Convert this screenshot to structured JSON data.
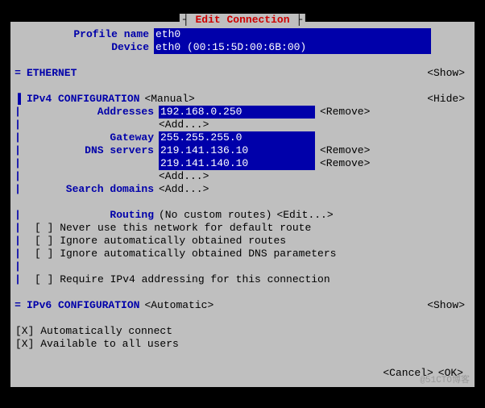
{
  "title_deco": "┤",
  "title_text": " Edit Connection ",
  "title_deco2": "├",
  "profile_name_label": "Profile name",
  "profile_name_value": "eth0",
  "device_label": "Device",
  "device_value": "eth0 (00:15:5D:00:6B:00)",
  "ethernet_label": "ETHERNET",
  "show_btn": "<Show>",
  "hide_btn": "<Hide>",
  "ipv4_label": "IPv4 CONFIGURATION",
  "ipv4_mode": "<Manual>",
  "addresses_label": "Addresses",
  "address1": "192.168.0.250",
  "remove_btn": "<Remove>",
  "add_btn": "<Add...>",
  "gateway_label": "Gateway",
  "gateway_value": "255.255.255.0",
  "dns_label": "DNS servers",
  "dns1": "219.141.136.10",
  "dns2": "219.141.140.10",
  "search_label": "Search domains",
  "routing_label": "Routing",
  "routing_value": "(No custom routes)",
  "edit_btn": "<Edit...>",
  "cb1": "[ ] Never use this network for default route",
  "cb2": "[ ] Ignore automatically obtained routes",
  "cb3": "[ ] Ignore automatically obtained DNS parameters",
  "cb4": "[ ] Require IPv4 addressing for this connection",
  "ipv6_label": "IPv6 CONFIGURATION",
  "ipv6_mode": "<Automatic>",
  "cb5": "[X] Automatically connect",
  "cb6": "[X] Available to all users",
  "cancel_btn": "<Cancel>",
  "ok_btn": "<OK>",
  "watermark": "@51CTO博客",
  "marker_eq": "=",
  "marker_bar": "▐",
  "marker_pipe": "|"
}
